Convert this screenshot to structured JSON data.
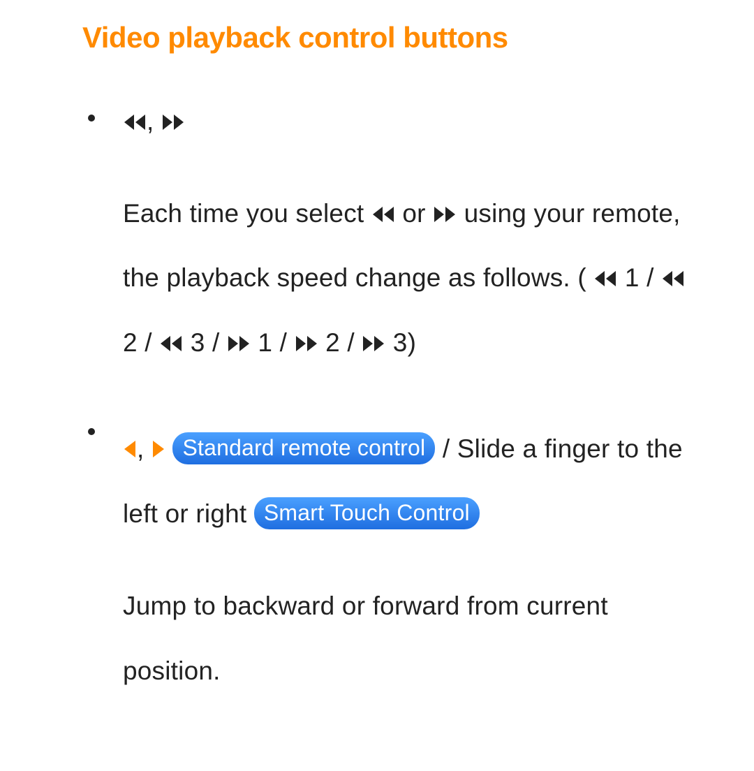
{
  "title": "Video playback control buttons",
  "sep": ", ",
  "bullets": [
    {
      "head": {
        "rewind_icon": "rewind",
        "forward_icon": "fast-forward"
      },
      "body": {
        "p1": "Each time you select ",
        "p2": " or ",
        "p3": " using your remote, the playback speed change as follows. (",
        "s1": " 1 / ",
        "s2": " 2 / ",
        "s3": " 3 / ",
        "s4": " 1 / ",
        "s5": " 2 / ",
        "s6": " 3)"
      }
    },
    {
      "head": {
        "left_icon": "triangle-left",
        "right_icon": "triangle-right",
        "badge1": "Standard remote control",
        "mid": " / Slide a finger to the left or right ",
        "badge2": "Smart Touch Control"
      },
      "body": {
        "text": "Jump to backward or forward from current position."
      }
    }
  ]
}
